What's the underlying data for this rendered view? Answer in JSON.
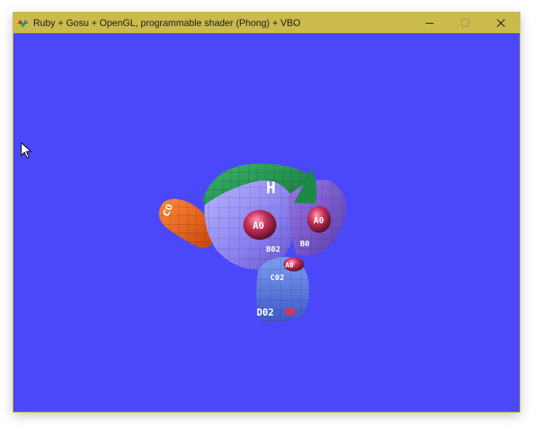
{
  "window": {
    "title": "Ruby + Gosu + OpenGL, programmable shader (Phong) + VBO",
    "controls": {
      "minimize": "minimize",
      "maximize": "maximize",
      "close": "close"
    },
    "colors": {
      "titlebar": "#cbba4c",
      "background": "#4a48f8"
    }
  },
  "viewport": {
    "subject": "textured 3D monkey head model",
    "labels": {
      "head_top": "H",
      "eye_left": "A0",
      "eye_right": "A0",
      "cheek_left": "B02",
      "cheek_right": "B0",
      "nose": "A0",
      "mouth": "C02",
      "chin": "D02",
      "ear": "C0"
    }
  }
}
